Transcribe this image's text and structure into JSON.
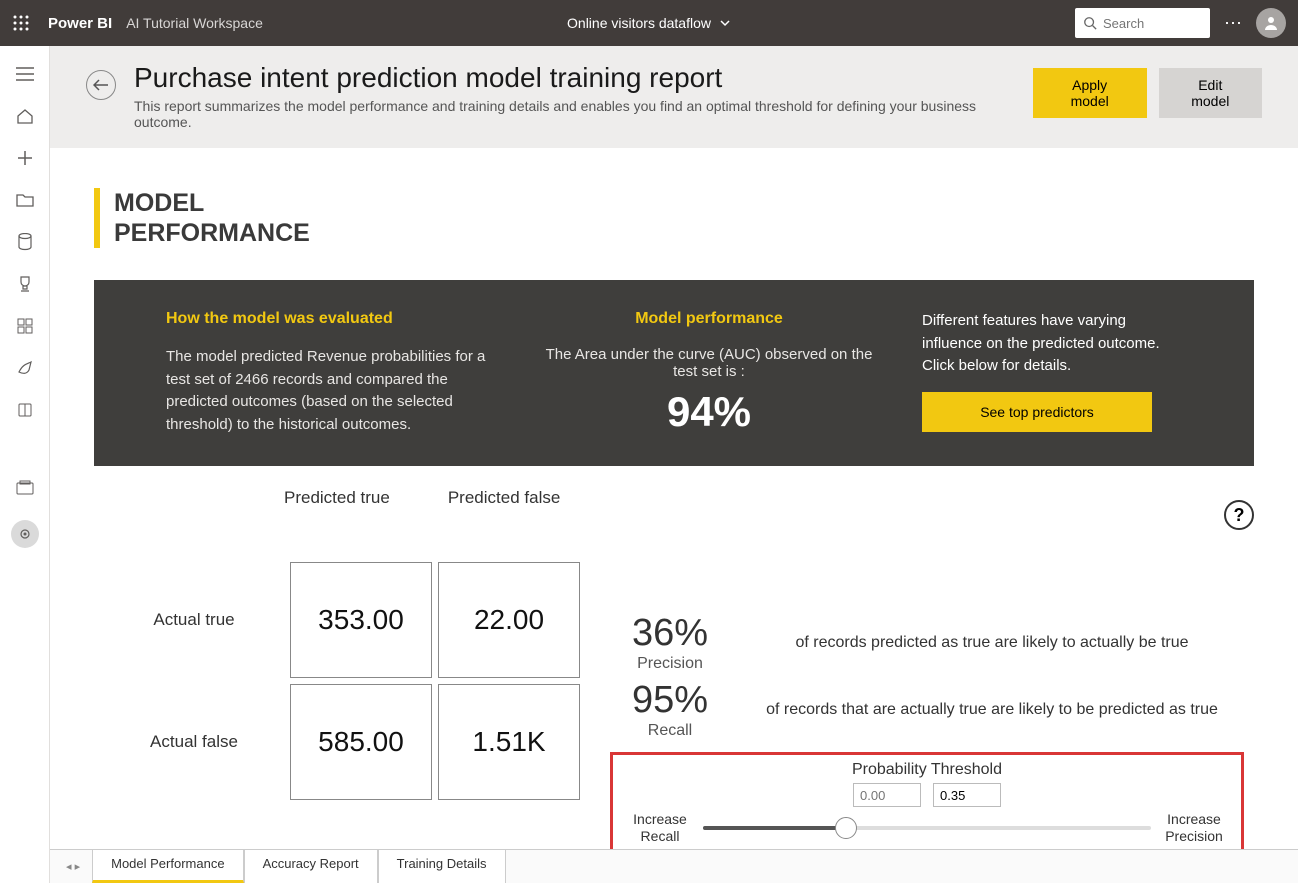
{
  "topbar": {
    "brand": "Power BI",
    "workspace": "AI Tutorial Workspace",
    "center_title": "Online visitors dataflow",
    "search_placeholder": "Search"
  },
  "header": {
    "title": "Purchase intent prediction model training report",
    "subtitle": "This report summarizes the model performance and training details and enables you find an optimal threshold for defining your business outcome.",
    "apply_label": "Apply model",
    "edit_label": "Edit model"
  },
  "section": {
    "title_line1": "MODEL",
    "title_line2": "PERFORMANCE"
  },
  "dark_panel": {
    "col1_title": "How the model was evaluated",
    "col1_body": "The model predicted Revenue probabilities for a test set of 2466 records and compared the predicted outcomes (based on the selected threshold) to the historical outcomes.",
    "col2_title": "Model performance",
    "col2_sub": "The Area under the curve (AUC) observed on the test set is :",
    "col2_big": "94%",
    "col3_text": "Different features have varying influence on the predicted outcome.  Click below for details.",
    "col3_button": "See top predictors"
  },
  "matrix": {
    "col_true": "Predicted true",
    "col_false": "Predicted false",
    "row_true": "Actual true",
    "row_false": "Actual false",
    "cells": {
      "tt": "353.00",
      "tf": "22.00",
      "ft": "585.00",
      "ff": "1.51K"
    }
  },
  "metrics": {
    "precision_val": "36%",
    "precision_lbl": "Precision",
    "precision_desc": "of records predicted as true are likely to actually be true",
    "recall_val": "95%",
    "recall_lbl": "Recall",
    "recall_desc": "of records that are actually true are likely to be predicted as true"
  },
  "threshold": {
    "title": "Probability Threshold",
    "min_placeholder": "0.00",
    "value": "0.35",
    "left_lbl_1": "Increase",
    "left_lbl_2": "Recall",
    "right_lbl_1": "Increase",
    "right_lbl_2": "Precision"
  },
  "tabs": {
    "t1": "Model Performance",
    "t2": "Accuracy Report",
    "t3": "Training Details"
  },
  "chart_data": {
    "type": "table",
    "title": "Confusion Matrix",
    "row_labels": [
      "Actual true",
      "Actual false"
    ],
    "col_labels": [
      "Predicted true",
      "Predicted false"
    ],
    "values": [
      [
        353.0,
        22.0
      ],
      [
        585.0,
        1510
      ]
    ],
    "metrics": {
      "AUC": 0.94,
      "Precision": 0.36,
      "Recall": 0.95
    },
    "threshold": 0.35
  }
}
